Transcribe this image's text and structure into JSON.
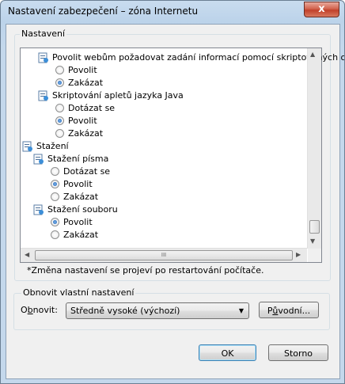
{
  "window": {
    "title": "Nastavení zabezpečení – zóna Internetu",
    "close_glyph": "x"
  },
  "settings_group": {
    "label": "Nastavení"
  },
  "tree": {
    "items": [
      {
        "kind": "setting",
        "label": "Povolit webům požadovat zadání informací pomocí skriptovaných oken",
        "icon": "setting-icon"
      },
      {
        "kind": "option",
        "label": "Povolit",
        "checked": false
      },
      {
        "kind": "option",
        "label": "Zakázat",
        "checked": true
      },
      {
        "kind": "setting",
        "label": "Skriptování apletů jazyka Java",
        "icon": "setting-icon"
      },
      {
        "kind": "option",
        "label": "Dotázat se",
        "checked": false
      },
      {
        "kind": "option",
        "label": "Povolit",
        "checked": true
      },
      {
        "kind": "option",
        "label": "Zakázat",
        "checked": false
      },
      {
        "kind": "category",
        "label": "Stažení",
        "icon": "download-category-icon"
      },
      {
        "kind": "setting",
        "label": "Stažení písma",
        "icon": "download-setting-icon"
      },
      {
        "kind": "option",
        "label": "Dotázat se",
        "checked": false
      },
      {
        "kind": "option",
        "label": "Povolit",
        "checked": true
      },
      {
        "kind": "option",
        "label": "Zakázat",
        "checked": false
      },
      {
        "kind": "setting",
        "label": "Stažení souboru",
        "icon": "download-setting-icon"
      },
      {
        "kind": "option",
        "label": "Povolit",
        "checked": true
      },
      {
        "kind": "option",
        "label": "Zakázat",
        "checked": false
      }
    ],
    "hscroll_grip": "III"
  },
  "note": "*Změna nastavení se projeví po restartování počítače.",
  "reset_group": {
    "label": "Obnovit vlastní nastavení",
    "reset_label_prefix": "O",
    "reset_label_u": "b",
    "reset_label_suffix": "novit:",
    "selected_level": "Středně vysoké (výchozí)",
    "original_prefix": "P",
    "original_u": "ů",
    "original_suffix": "vodní..."
  },
  "buttons": {
    "ok": "OK",
    "cancel": "Storno"
  }
}
